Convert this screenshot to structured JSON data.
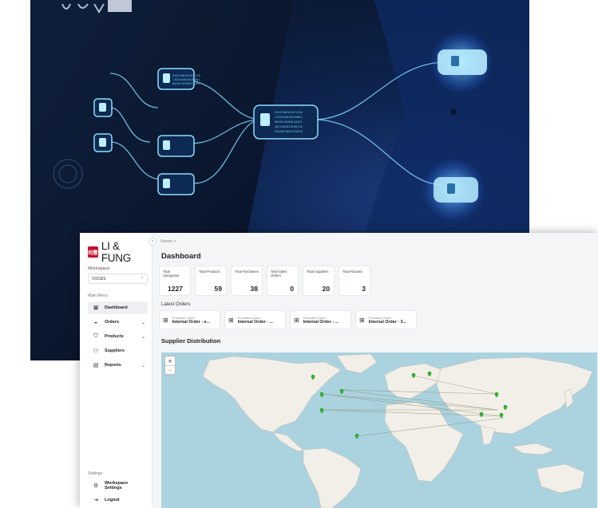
{
  "brand": {
    "name": "LI & FUNG",
    "mark": "利豐"
  },
  "workspace": {
    "label": "Workspace",
    "selected": "VOCES",
    "chevron": "⌃"
  },
  "sidebar": {
    "menu_title": "Main Menu",
    "items": [
      {
        "label": "Dashboard",
        "icon": "grid-icon",
        "glyph": "⊞",
        "chevron": ""
      },
      {
        "label": "Orders",
        "icon": "orders-icon",
        "glyph": "◒",
        "chevron": "⌄"
      },
      {
        "label": "Products",
        "icon": "products-icon",
        "glyph": "⛉",
        "chevron": "⌄"
      },
      {
        "label": "Suppliers",
        "icon": "suppliers-icon",
        "glyph": "⚇",
        "chevron": ""
      },
      {
        "label": "Reports",
        "icon": "reports-icon",
        "glyph": "▤",
        "chevron": "⌄"
      }
    ],
    "settings_title": "Settings",
    "settings_items": [
      {
        "label": "Workspace Settings",
        "icon": "gear-icon",
        "glyph": "⚙"
      },
      {
        "label": "Logout",
        "icon": "logout-icon",
        "glyph": "⇥"
      }
    ]
  },
  "header": {
    "breadcrumb": "Home  >",
    "title": "Dashboard",
    "collapse_glyph": "‹"
  },
  "stats": [
    {
      "label": "Total Categories",
      "value": "1227"
    },
    {
      "label": "Total Products",
      "value": "59"
    },
    {
      "label": "Total Purchases",
      "value": "38"
    },
    {
      "label": "Total Sales Orders",
      "value": "0"
    },
    {
      "label": "Total Suppliers",
      "value": "20"
    },
    {
      "label": "Total Rubrats",
      "value": "3"
    }
  ],
  "latest_orders": {
    "title": "Latest Orders",
    "items": [
      {
        "type": "Purchase Order",
        "title": "Internal Order - e..."
      },
      {
        "type": "Purchase Order",
        "title": "Internal Order - ..."
      },
      {
        "type": "Purchase Order",
        "title": "Internal Order - ..."
      },
      {
        "type": "Purchase Order",
        "title": "Internal Order - 3..."
      }
    ]
  },
  "map": {
    "title": "Supplier Distribution",
    "zoom_in": "+",
    "zoom_out": "−",
    "water_color": "#aad3df",
    "land_color": "#f2efe9",
    "pin_color": "#2eb82e"
  },
  "hero": {
    "code_text": "0101100101011110",
    "colors": {
      "glow": "#7fd4ff",
      "dark": "#0b1a36"
    }
  }
}
